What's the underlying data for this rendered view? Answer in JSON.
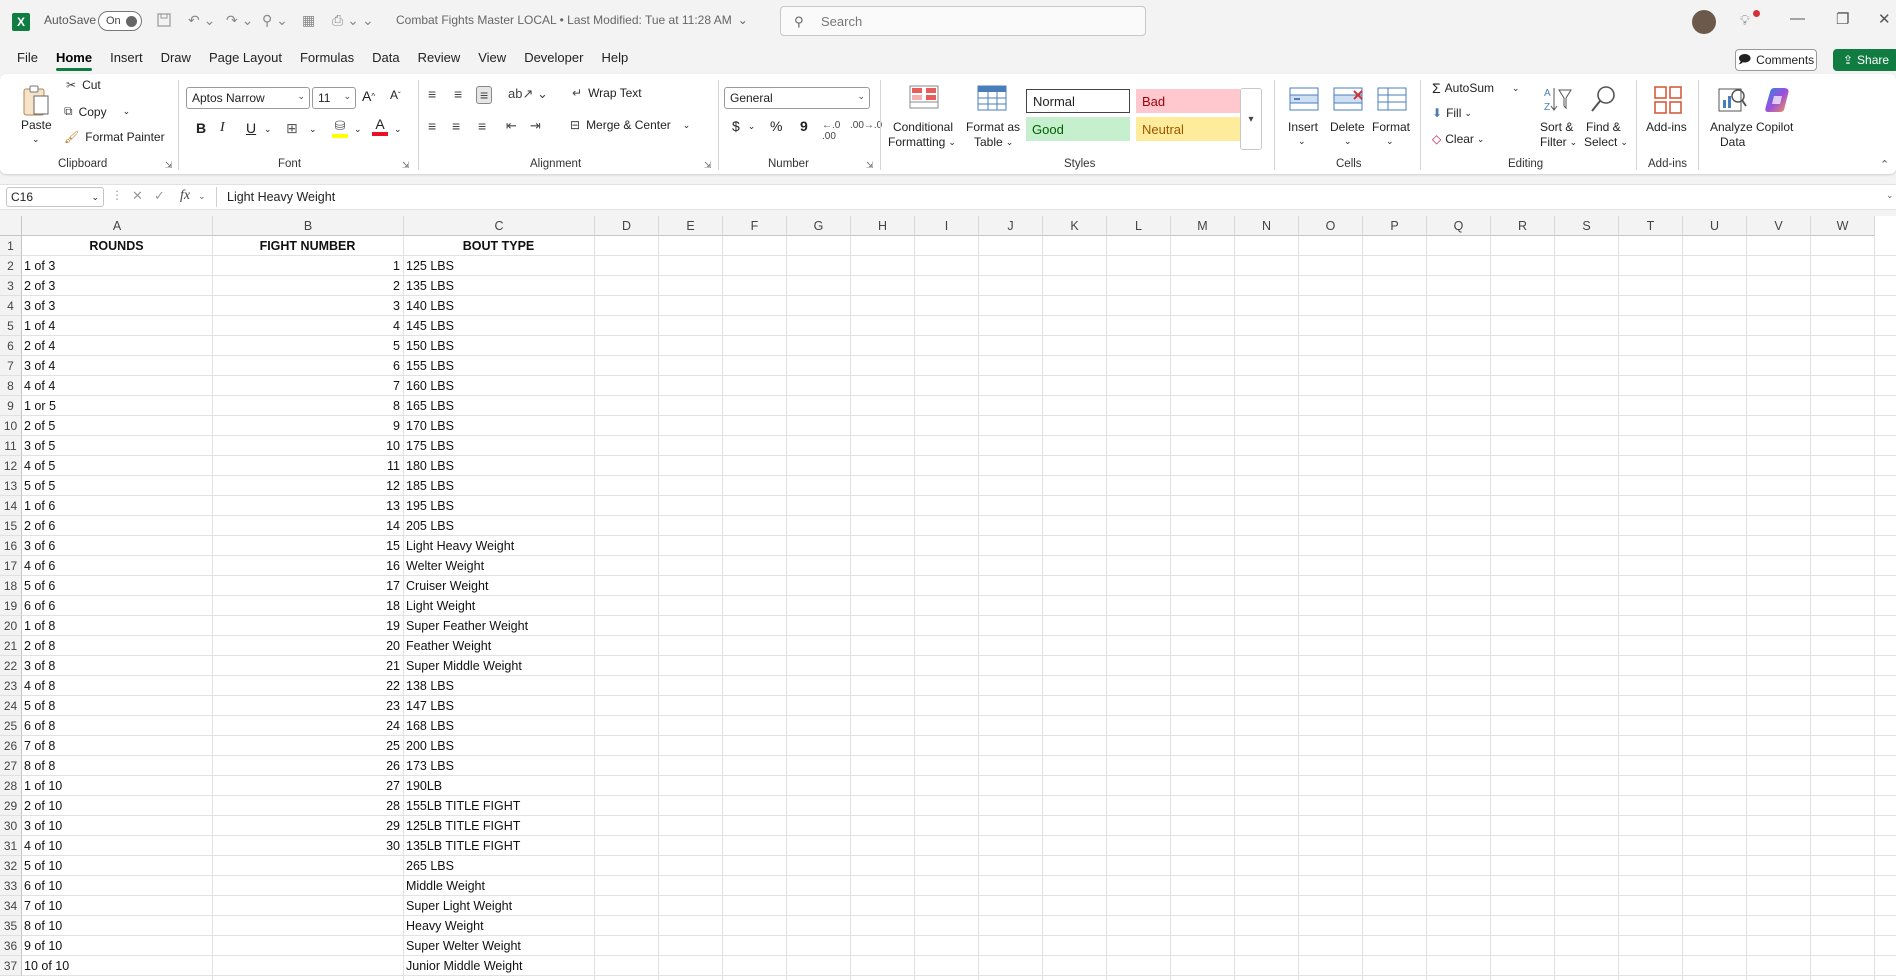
{
  "app": {
    "logo": "X",
    "autosave_label": "AutoSave",
    "autosave_state": "On",
    "title": "Combat Fights Master LOCAL  •  Last Modified: Tue at 11:28 AM",
    "search_placeholder": "Search",
    "accent": "#107c41"
  },
  "menu": {
    "tabs": [
      "File",
      "Home",
      "Insert",
      "Draw",
      "Page Layout",
      "Formulas",
      "Data",
      "Review",
      "View",
      "Developer",
      "Help"
    ],
    "active": "Home",
    "comments_label": "Comments",
    "share_label": "Share"
  },
  "ribbon": {
    "clipboard": {
      "paste": "Paste",
      "cut": "Cut",
      "copy": "Copy",
      "format_painter": "Format Painter",
      "label": "Clipboard"
    },
    "font": {
      "name": "Aptos Narrow",
      "size": "11",
      "bold": "B",
      "italic": "I",
      "underline": "U",
      "label": "Font"
    },
    "alignment": {
      "wrap": "Wrap Text",
      "merge": "Merge & Center",
      "label": "Alignment"
    },
    "number": {
      "format": "General",
      "currency": "$",
      "percent": "%",
      "comma": "9",
      "label": "Number"
    },
    "styles": {
      "conditional": "Conditional",
      "conditional2": "Formatting",
      "format_table": "Format as",
      "format_table2": "Table",
      "normal": "Normal",
      "bad": "Bad",
      "good": "Good",
      "neutral": "Neutral",
      "label": "Styles"
    },
    "cells": {
      "insert": "Insert",
      "delete": "Delete",
      "format": "Format",
      "label": "Cells"
    },
    "editing": {
      "autosum": "AutoSum",
      "fill": "Fill",
      "clear": "Clear",
      "sort": "Sort &",
      "sort2": "Filter",
      "find": "Find &",
      "find2": "Select",
      "label": "Editing"
    },
    "addins": {
      "addins": "Add-ins",
      "label": "Add-ins",
      "analyze": "Analyze",
      "analyze2": "Data",
      "copilot": "Copilot"
    }
  },
  "formula_bar": {
    "name_box": "C16",
    "fx": "fx",
    "content": "Light Heavy Weight"
  },
  "sheet": {
    "columns": [
      "A",
      "B",
      "C",
      "D",
      "E",
      "F",
      "G",
      "H",
      "I",
      "J",
      "K",
      "L",
      "M",
      "N",
      "O",
      "P",
      "Q",
      "R",
      "S",
      "T",
      "U",
      "V",
      "W"
    ],
    "row_numbers": [
      "1",
      "2",
      "3",
      "4",
      "5",
      "6",
      "7",
      "8",
      "9",
      "10",
      "11",
      "12",
      "13",
      "14",
      "15",
      "16",
      "17",
      "18",
      "19",
      "20",
      "21",
      "22",
      "23",
      "24",
      "25",
      "26",
      "27",
      "28",
      "29",
      "30",
      "31",
      "32",
      "33",
      "34",
      "35",
      "36",
      "37"
    ],
    "headers": {
      "a": "ROUNDS",
      "b": "FIGHT NUMBER",
      "c": "BOUT TYPE"
    },
    "rows": [
      {
        "a": "1 of 3",
        "b": "1",
        "c": "125 LBS"
      },
      {
        "a": "2 of 3",
        "b": "2",
        "c": "135 LBS"
      },
      {
        "a": "3 of 3",
        "b": "3",
        "c": "140 LBS"
      },
      {
        "a": "1 of 4",
        "b": "4",
        "c": "145 LBS"
      },
      {
        "a": "2 of 4",
        "b": "5",
        "c": "150 LBS"
      },
      {
        "a": "3 of 4",
        "b": "6",
        "c": "155 LBS"
      },
      {
        "a": "4 of 4",
        "b": "7",
        "c": "160 LBS"
      },
      {
        "a": "1 or 5",
        "b": "8",
        "c": "165 LBS"
      },
      {
        "a": "2 of 5",
        "b": "9",
        "c": "170 LBS"
      },
      {
        "a": "3 of 5",
        "b": "10",
        "c": "175 LBS"
      },
      {
        "a": "4 of 5",
        "b": "11",
        "c": "180 LBS"
      },
      {
        "a": "5 of 5",
        "b": "12",
        "c": "185 LBS"
      },
      {
        "a": "1 of 6",
        "b": "13",
        "c": "195 LBS"
      },
      {
        "a": "2 of 6",
        "b": "14",
        "c": "205 LBS"
      },
      {
        "a": "3 of 6",
        "b": "15",
        "c": "Light Heavy Weight"
      },
      {
        "a": "4 of 6",
        "b": "16",
        "c": "Welter Weight"
      },
      {
        "a": "5 of 6",
        "b": "17",
        "c": "Cruiser Weight"
      },
      {
        "a": "6 of 6",
        "b": "18",
        "c": "Light Weight"
      },
      {
        "a": "1 of 8",
        "b": "19",
        "c": "Super Feather Weight"
      },
      {
        "a": "2 of 8",
        "b": "20",
        "c": "Feather Weight"
      },
      {
        "a": "3 of 8",
        "b": "21",
        "c": "Super Middle Weight"
      },
      {
        "a": "4 of 8",
        "b": "22",
        "c": "138 LBS"
      },
      {
        "a": "5 of 8",
        "b": "23",
        "c": "147 LBS"
      },
      {
        "a": "6 of 8",
        "b": "24",
        "c": "168 LBS"
      },
      {
        "a": "7 of 8",
        "b": "25",
        "c": "200 LBS"
      },
      {
        "a": "8 of 8",
        "b": "26",
        "c": "173 LBS"
      },
      {
        "a": "1 of 10",
        "b": "27",
        "c": "190LB"
      },
      {
        "a": "2 of 10",
        "b": "28",
        "c": "155LB TITLE FIGHT"
      },
      {
        "a": "3 of 10",
        "b": "29",
        "c": "125LB TITLE FIGHT"
      },
      {
        "a": "4 of 10",
        "b": "30",
        "c": "135LB TITLE FIGHT"
      },
      {
        "a": "5 of 10",
        "b": "",
        "c": "265 LBS"
      },
      {
        "a": " 6 of 10",
        "b": "",
        "c": "Middle Weight"
      },
      {
        "a": " 7 of 10",
        "b": "",
        "c": "Super Light Weight"
      },
      {
        "a": " 8 of 10",
        "b": "",
        "c": "Heavy Weight"
      },
      {
        "a": "9 of 10",
        "b": "",
        "c": "Super Welter Weight"
      },
      {
        "a": "10 of 10",
        "b": "",
        "c": "Junior Middle Weight"
      }
    ]
  }
}
